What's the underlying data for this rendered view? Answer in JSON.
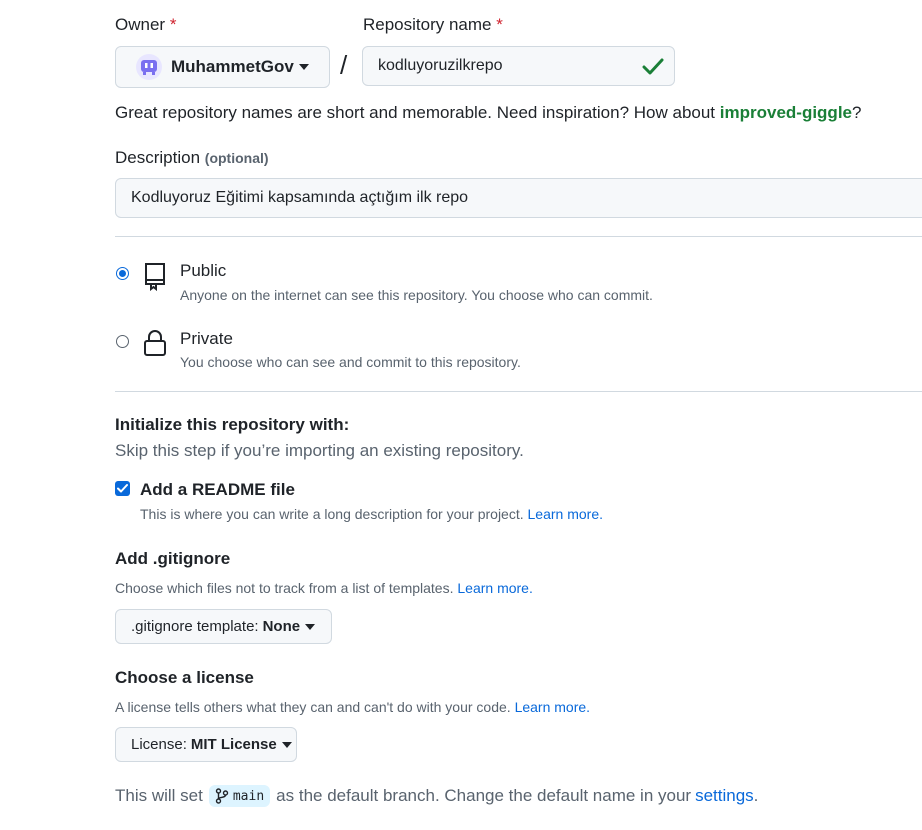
{
  "owner": {
    "label": "Owner",
    "required_mark": "*",
    "selected": "MuhammetGov",
    "separator": "/"
  },
  "repo": {
    "label": "Repository name",
    "required_mark": "*",
    "value": "kodluyoruzilkrepo",
    "hint_prefix": "Great repository names are short and memorable. Need inspiration? How about ",
    "suggestion": "improved-giggle",
    "hint_suffix": "?"
  },
  "description": {
    "label": "Description",
    "optional": "(optional)",
    "value": "Kodluyoruz Eğitimi kapsamında açtığım ilk repo"
  },
  "visibility": {
    "public": {
      "title": "Public",
      "desc": "Anyone on the internet can see this repository. You choose who can commit.",
      "checked": true
    },
    "private": {
      "title": "Private",
      "desc": "You choose who can see and commit to this repository.",
      "checked": false
    }
  },
  "init": {
    "heading": "Initialize this repository with:",
    "subheading": "Skip this step if you’re importing an existing repository.",
    "readme": {
      "label": "Add a README file",
      "desc": "This is where you can write a long description for your project.",
      "learn": "Learn more.",
      "checked": true
    }
  },
  "gitignore": {
    "heading": "Add .gitignore",
    "desc": "Choose which files not to track from a list of templates.",
    "learn": "Learn more.",
    "button_prefix": ".gitignore template:",
    "button_value": "None"
  },
  "license": {
    "heading": "Choose a license",
    "desc": "A license tells others what they can and can't do with your code.",
    "learn": "Learn more.",
    "button_prefix": "License:",
    "button_value": "MIT License"
  },
  "branch": {
    "prefix": "This will set",
    "name": "main",
    "middle": "as the default branch. Change the default name in your",
    "settings": "settings",
    "suffix": "."
  },
  "colors": {
    "accent": "#0969da",
    "success": "#1a7f37",
    "danger": "#cf222e"
  }
}
